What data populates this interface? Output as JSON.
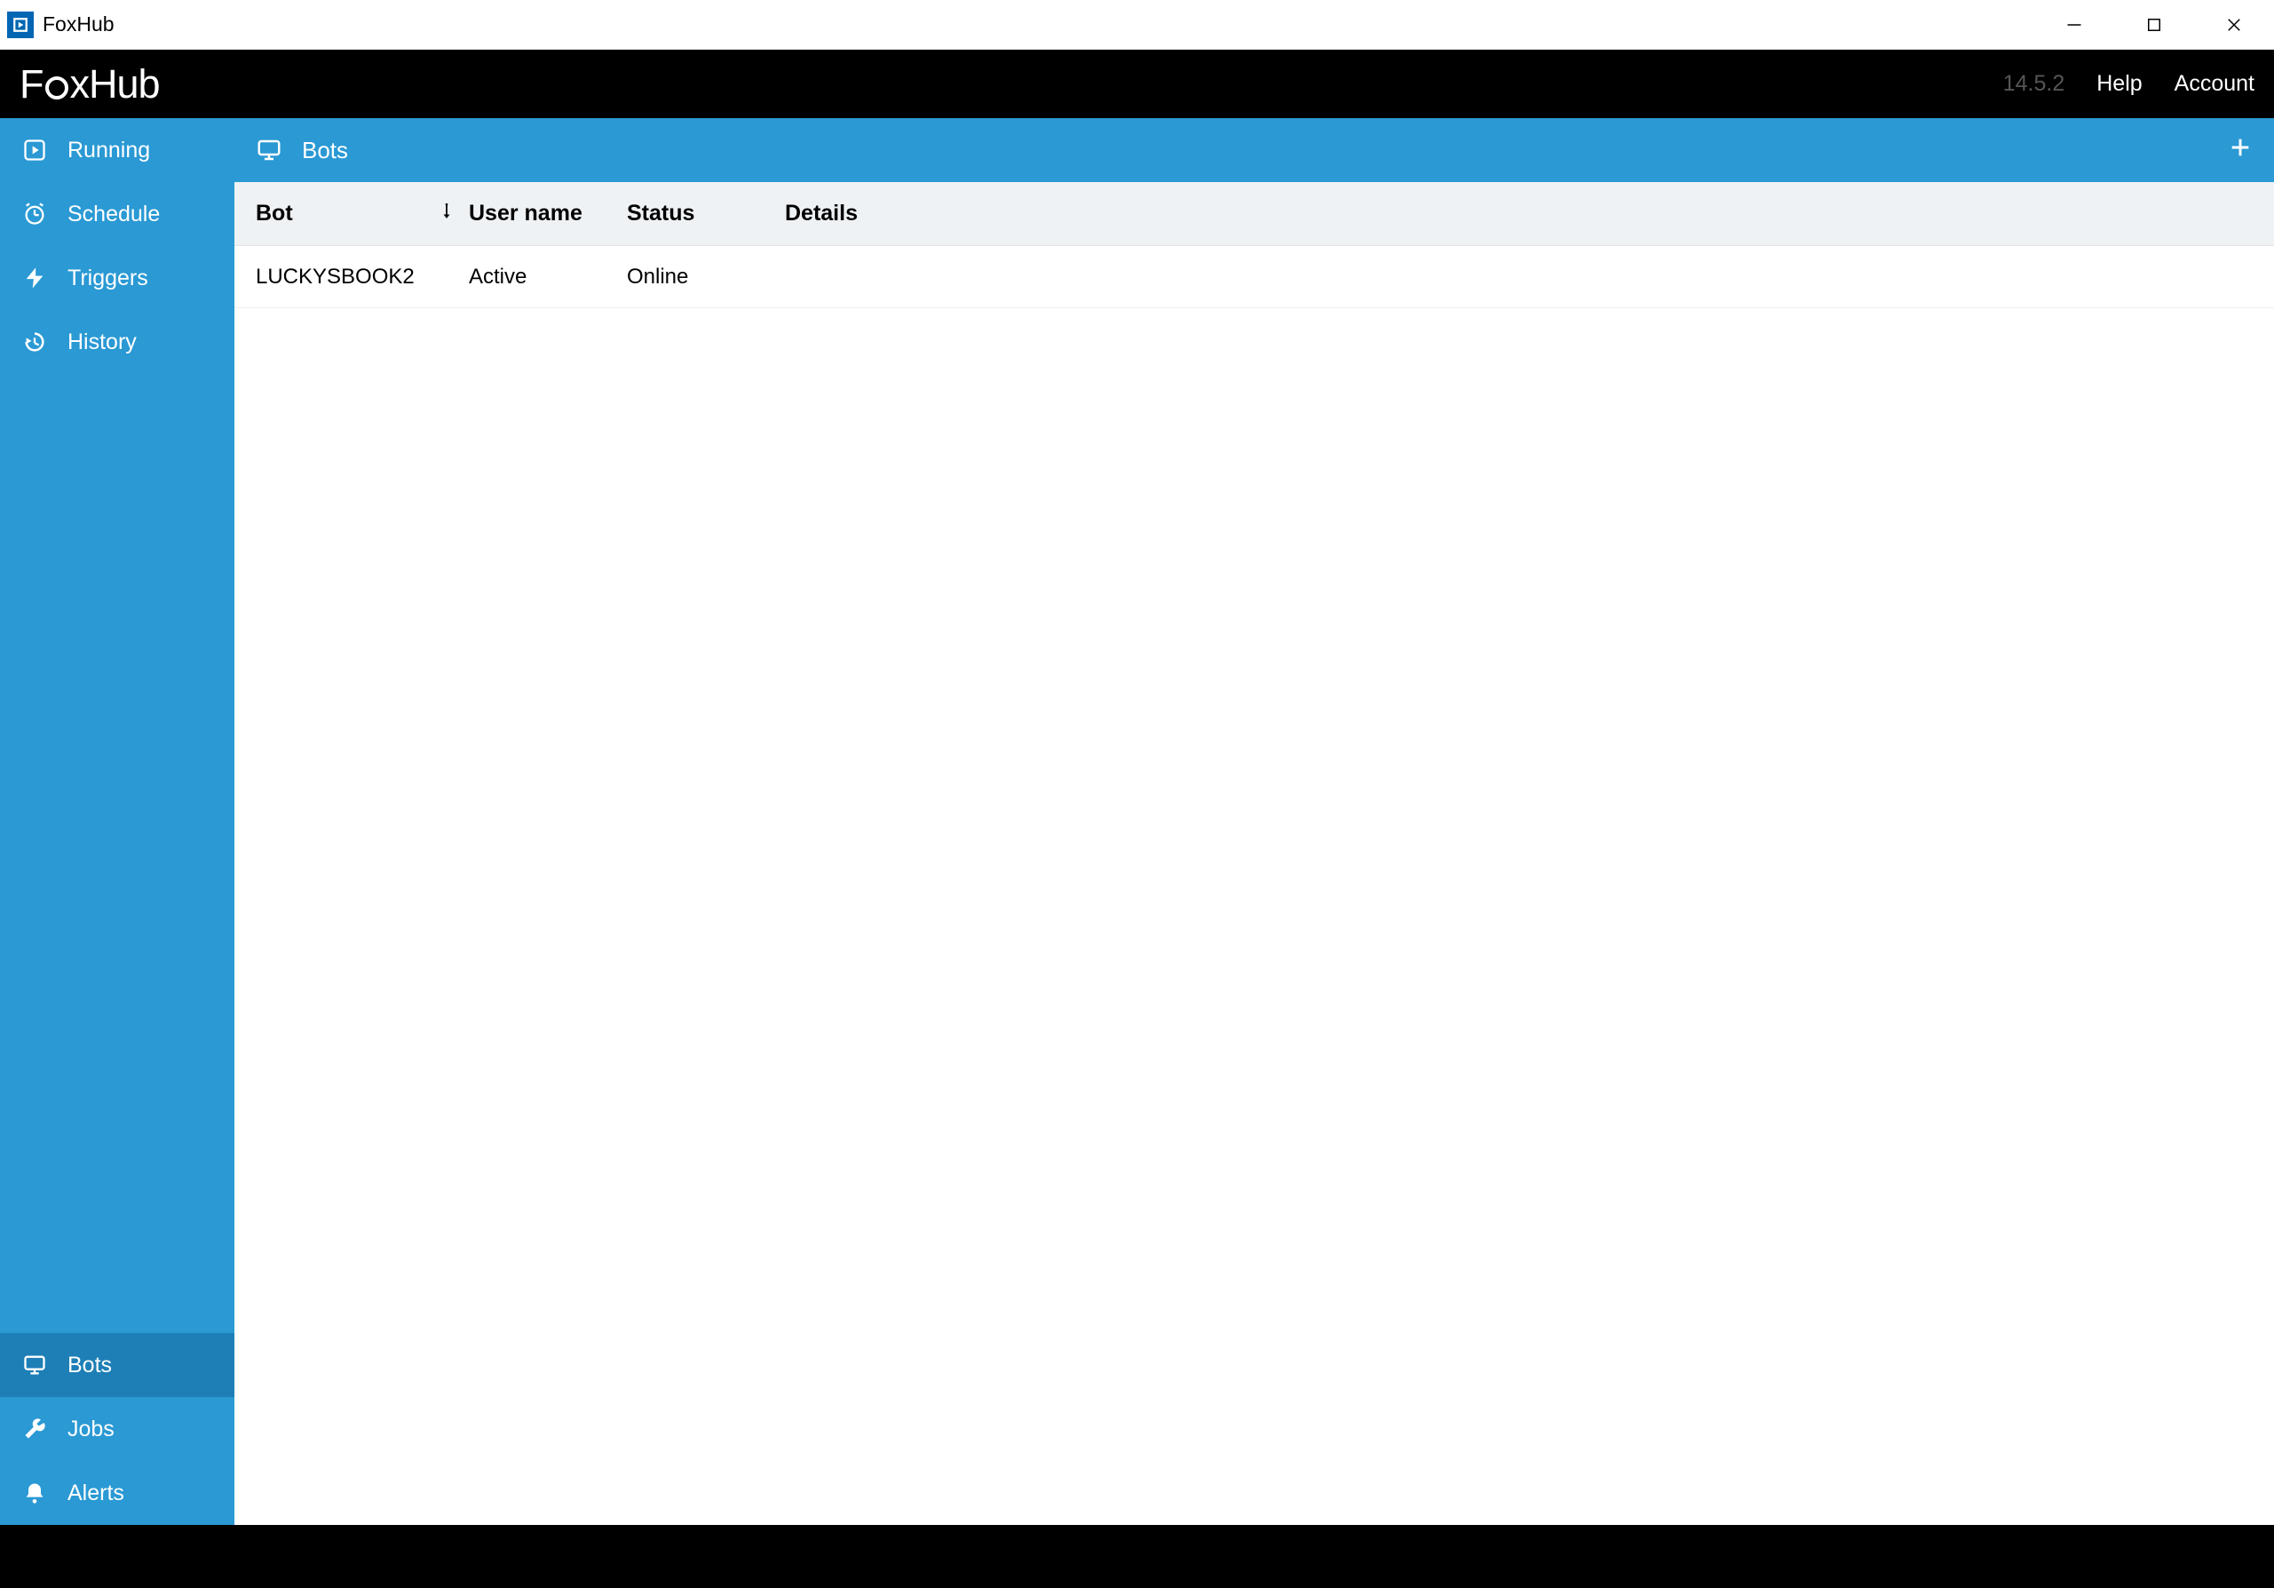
{
  "window": {
    "title": "FoxHub"
  },
  "topbar": {
    "logo_prefix": "F",
    "logo_suffix": "xHub",
    "version": "14.5.2",
    "help": "Help",
    "account": "Account"
  },
  "sidebar": {
    "top": [
      {
        "key": "running",
        "label": "Running",
        "icon": "play-circle-icon"
      },
      {
        "key": "schedule",
        "label": "Schedule",
        "icon": "alarm-icon"
      },
      {
        "key": "triggers",
        "label": "Triggers",
        "icon": "bolt-icon"
      },
      {
        "key": "history",
        "label": "History",
        "icon": "history-icon"
      }
    ],
    "bottom": [
      {
        "key": "bots",
        "label": "Bots",
        "icon": "monitor-icon",
        "selected": true
      },
      {
        "key": "jobs",
        "label": "Jobs",
        "icon": "wrench-icon"
      },
      {
        "key": "alerts",
        "label": "Alerts",
        "icon": "bell-icon"
      }
    ]
  },
  "section": {
    "title": "Bots"
  },
  "table": {
    "columns": {
      "bot": "Bot",
      "user": "User name",
      "status": "Status",
      "details": "Details"
    },
    "rows": [
      {
        "bot": "LUCKYSBOOK2",
        "user": "Active",
        "status": "Online",
        "details": ""
      }
    ]
  }
}
